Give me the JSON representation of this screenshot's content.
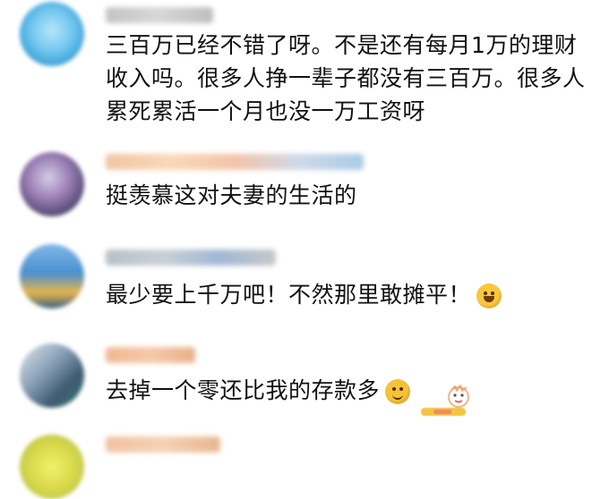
{
  "comments": [
    {
      "text": "三百万已经不错了呀。不是还有每月1万的理财收入吗。很多人挣一辈子都没有三百万。很多人累死累活一个月也没一万工资呀"
    },
    {
      "text": "挺羡慕这对夫妻的生活的"
    },
    {
      "text": "最少要上千万吧！不然那里敢摊平！",
      "emoji": "laughing-tears-icon"
    },
    {
      "text": "去掉一个零还比我的存款多",
      "emoji": "smile-icon",
      "sticker": "cartoon-kid-sticker"
    },
    {
      "text": ""
    }
  ],
  "colors": {
    "text": "#111111",
    "emoji": "#f6c23a",
    "name_blur": "#b9b9b9"
  }
}
